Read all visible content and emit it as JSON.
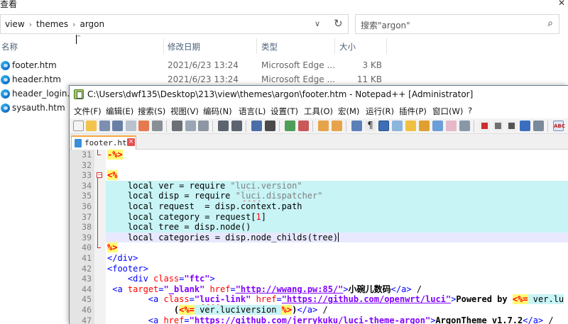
{
  "explorer": {
    "menu_partial": "查看",
    "close_glyph": "✕",
    "breadcrumb": [
      "view",
      "themes",
      "argon"
    ],
    "search_placeholder": "搜索\"argon\"",
    "columns": {
      "name": "名称",
      "date": "修改日期",
      "type": "类型",
      "size": "大小"
    },
    "files": [
      {
        "name": "footer.htm",
        "date": "2021/6/23 13:24",
        "type": "Microsoft Edge ...",
        "size": "3 KB"
      },
      {
        "name": "header.htm",
        "date": "2021/6/23 13:24",
        "type": "Microsoft Edge ...",
        "size": "11 KB"
      },
      {
        "name": "header_login.htm",
        "date": "",
        "type": "",
        "size": ""
      },
      {
        "name": "sysauth.htm",
        "date": "",
        "type": "",
        "size": ""
      }
    ]
  },
  "notepad": {
    "title": "C:\\Users\\dwf135\\Desktop\\213\\view\\themes\\argon\\footer.htm - Notepad++ [Administrator]",
    "menu": [
      "文件(F)",
      "编辑(E)",
      "搜索(S)",
      "视图(V)",
      "编码(N)",
      "语言(L)",
      "设置(T)",
      "工具(O)",
      "宏(M)",
      "运行(R)",
      "插件(P)",
      "窗口(W)",
      "?"
    ],
    "tab_label": "footer.htm",
    "lines": [
      {
        "n": "31",
        "segments": [
          [
            "del",
            "-%>"
          ]
        ]
      },
      {
        "n": "32",
        "segments": []
      },
      {
        "n": "33",
        "segments": [
          [
            "del",
            "<%"
          ]
        ]
      },
      {
        "n": "34",
        "segments": [
          [
            "plain",
            "    local ver = require "
          ],
          [
            "lstr",
            "\""
          ],
          [
            "lstrsq",
            "luci"
          ],
          [
            "lstr",
            ".version\""
          ]
        ]
      },
      {
        "n": "35",
        "segments": [
          [
            "plain",
            "    local disp = require "
          ],
          [
            "lstr",
            "\""
          ],
          [
            "lstrsq",
            "luci"
          ],
          [
            "lstr",
            ".dispatcher\""
          ]
        ]
      },
      {
        "n": "36",
        "segments": [
          [
            "plain",
            "    local request  = disp.context.path"
          ]
        ]
      },
      {
        "n": "37",
        "segments": [
          [
            "plain",
            "    local category = request["
          ],
          [
            "num",
            "1"
          ],
          [
            "plain",
            "]"
          ]
        ]
      },
      {
        "n": "38",
        "segments": [
          [
            "plain",
            "    local tree = disp.node()"
          ]
        ]
      },
      {
        "n": "39",
        "segments": [
          [
            "plain",
            "    local categories = disp.node_childs(tree)"
          ]
        ]
      },
      {
        "n": "40",
        "segments": [
          [
            "del",
            "%>"
          ]
        ]
      },
      {
        "n": "41",
        "segments": [
          [
            "tag",
            "</div>"
          ]
        ]
      },
      {
        "n": "42",
        "segments": [
          [
            "tag",
            "<footer>"
          ]
        ]
      },
      {
        "n": "43",
        "segments": [
          [
            "plain",
            "    "
          ],
          [
            "tag",
            "<div "
          ],
          [
            "attr",
            "class"
          ],
          [
            "tag",
            "="
          ],
          [
            "str",
            "\"ftc\""
          ],
          [
            "tag",
            ">"
          ]
        ]
      },
      {
        "n": "44",
        "segments": [
          [
            "plain",
            " "
          ],
          [
            "tag",
            "<a "
          ],
          [
            "attr",
            "target"
          ],
          [
            "tag",
            "="
          ],
          [
            "str",
            "\"_blank\""
          ],
          [
            "plain",
            " "
          ],
          [
            "attr",
            "href"
          ],
          [
            "tag",
            "="
          ],
          [
            "strul",
            "\"http://wwang.pw:85/\""
          ],
          [
            "tag",
            ">"
          ],
          [
            "text",
            "小碗儿数码"
          ],
          [
            "tag",
            "</a>"
          ],
          [
            "plain",
            " /"
          ]
        ]
      },
      {
        "n": "45",
        "segments": [
          [
            "plain",
            "        "
          ],
          [
            "tag",
            "<a "
          ],
          [
            "attr",
            "class"
          ],
          [
            "tag",
            "="
          ],
          [
            "str",
            "\""
          ],
          [
            "strsq",
            "luci"
          ],
          [
            "str",
            "-link\""
          ],
          [
            "plain",
            " "
          ],
          [
            "attr",
            "href"
          ],
          [
            "tag",
            "="
          ],
          [
            "strul",
            "\"https://github.com/openwrt/luci\""
          ],
          [
            "tag",
            ">"
          ],
          [
            "text",
            "Powered by "
          ],
          [
            "del",
            "<%="
          ],
          [
            "emb",
            " ver.lu"
          ]
        ]
      },
      {
        "n": "46",
        "segments": [
          [
            "plain",
            "             "
          ],
          [
            "text",
            "("
          ],
          [
            "del",
            "<%="
          ],
          [
            "emb",
            " ver.luciversion "
          ],
          [
            "del",
            "%>"
          ],
          [
            "text",
            ")"
          ],
          [
            "tag",
            "</a>"
          ],
          [
            "plain",
            " /"
          ]
        ]
      },
      {
        "n": "47",
        "segments": [
          [
            "plain",
            "        "
          ],
          [
            "tag",
            "<a "
          ],
          [
            "attr",
            "href"
          ],
          [
            "tag",
            "="
          ],
          [
            "strul",
            "\"https://github.com/jerrykuku/luci-theme-argon\""
          ],
          [
            "tag",
            ">"
          ],
          [
            "text",
            "ArgonTheme v1.7.2"
          ],
          [
            "tag",
            "</a>"
          ],
          [
            "plain",
            " /"
          ]
        ]
      }
    ]
  }
}
